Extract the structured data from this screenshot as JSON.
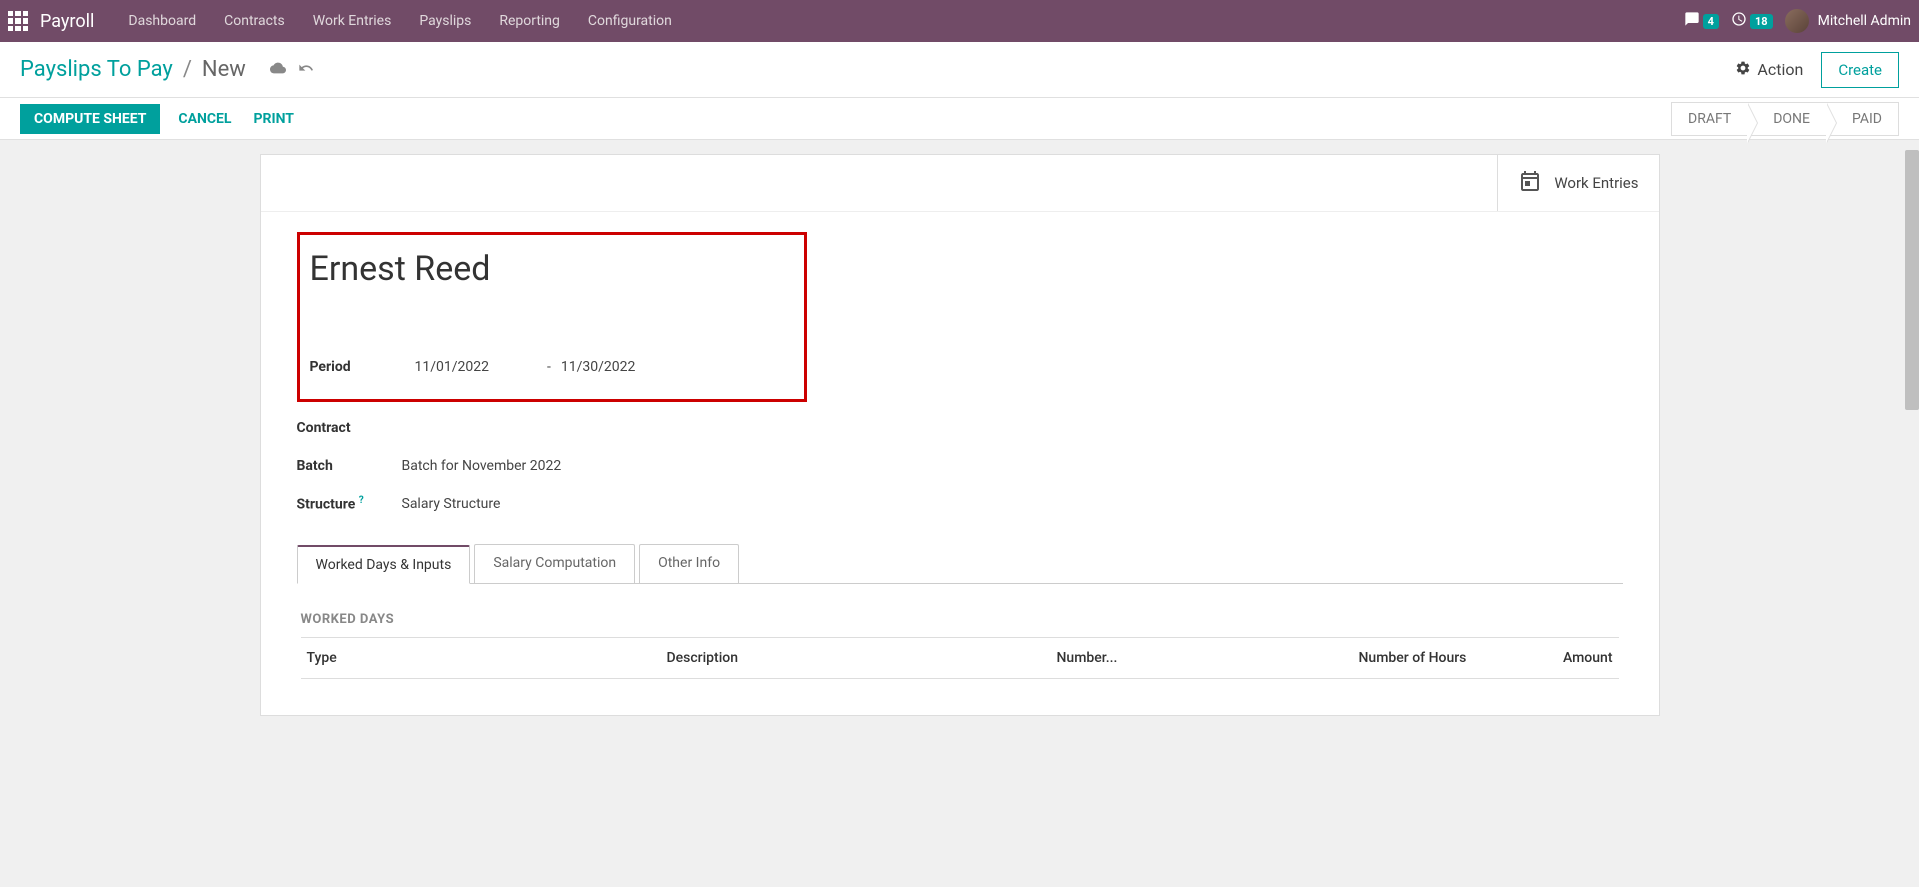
{
  "nav": {
    "app": "Payroll",
    "items": [
      "Dashboard",
      "Contracts",
      "Work Entries",
      "Payslips",
      "Reporting",
      "Configuration"
    ],
    "chat_count": "4",
    "clock_count": "18",
    "user": "Mitchell Admin"
  },
  "breadcrumb": {
    "parent": "Payslips To Pay",
    "current": "New",
    "action_label": "Action",
    "create_label": "Create"
  },
  "actions": {
    "compute": "COMPUTE SHEET",
    "cancel": "CANCEL",
    "print": "PRINT"
  },
  "status": [
    "DRAFT",
    "DONE",
    "PAID"
  ],
  "sheet": {
    "work_entries_btn": "Work Entries",
    "employee": "Ernest Reed",
    "fields": {
      "period_label": "Period",
      "period_from": "11/01/2022",
      "period_to": "11/30/2022",
      "period_sep": "-",
      "contract_label": "Contract",
      "contract_value": "",
      "batch_label": "Batch",
      "batch_value": "Batch for November 2022",
      "structure_label": "Structure",
      "structure_help": "?",
      "structure_value": "Salary Structure"
    }
  },
  "tabs": [
    "Worked Days & Inputs",
    "Salary Computation",
    "Other Info"
  ],
  "worked_days": {
    "title": "WORKED DAYS",
    "columns": {
      "type": "Type",
      "description": "Description",
      "number": "Number...",
      "hours": "Number of Hours",
      "amount": "Amount"
    }
  }
}
